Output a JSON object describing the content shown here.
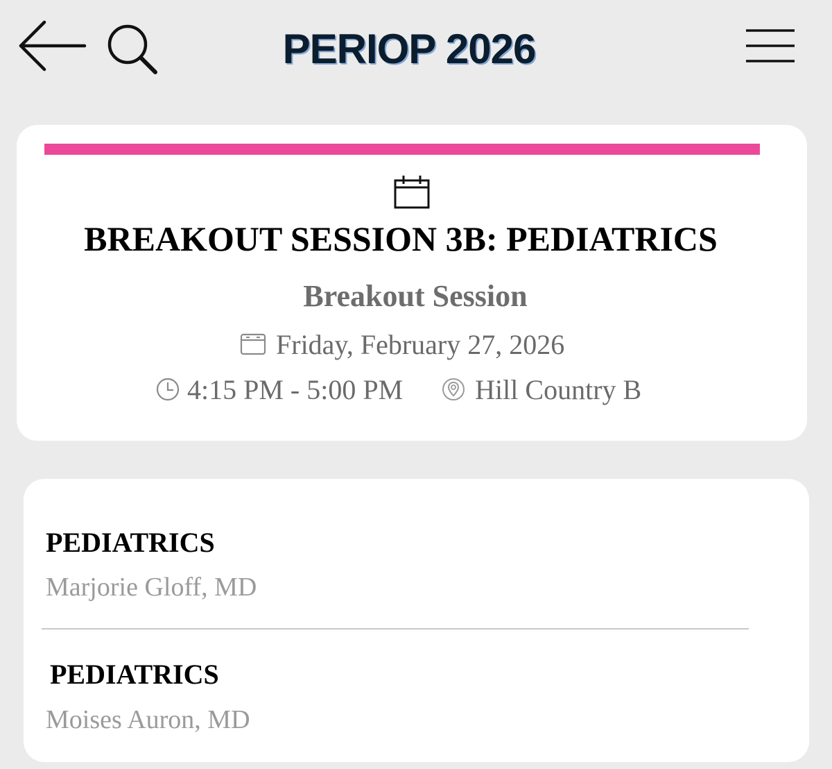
{
  "header": {
    "title": "PERIOP 2026",
    "back_icon": "arrow-left-icon",
    "search_icon": "search-icon",
    "menu_icon": "hamburger-menu-icon"
  },
  "session": {
    "accent_color": "#ec4899",
    "title": "BREAKOUT SESSION 3B: PEDIATRICS",
    "type": "Breakout Session",
    "date": "Friday, February 27, 2026",
    "time": "4:15 PM - 5:00 PM",
    "location": "Hill Country B"
  },
  "speakers": [
    {
      "title": "PEDIATRICS",
      "name": "Marjorie Gloff, MD"
    },
    {
      "title": "PEDIATRICS",
      "name": "Moises Auron, MD"
    }
  ]
}
